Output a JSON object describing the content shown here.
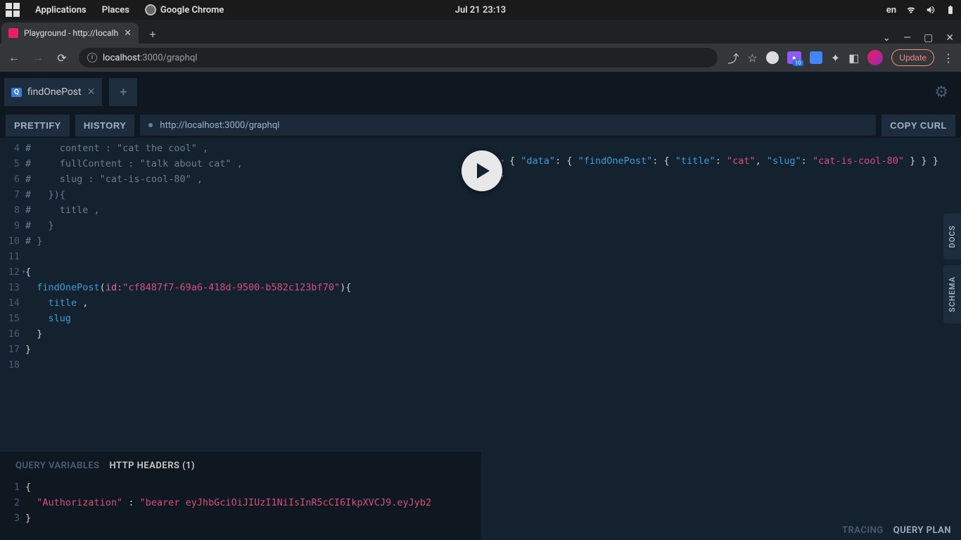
{
  "os": {
    "applications": "Applications",
    "places": "Places",
    "chrome": "Google Chrome",
    "datetime": "Jul 21  23:13",
    "lang": "en"
  },
  "browser": {
    "tab_title": "Playground - http://localh",
    "url_host": "localhost",
    "url_rest": ":3000/graphql",
    "update": "Update",
    "ext_badge": "10"
  },
  "playground": {
    "tab_name": "findOnePost",
    "prettify": "PRETTIFY",
    "history": "HISTORY",
    "endpoint": "http://localhost:3000/graphql",
    "copy_curl": "COPY CURL",
    "docs": "DOCS",
    "schema": "SCHEMA",
    "tracing": "TRACING",
    "query_plan": "QUERY PLAN",
    "qv_label": "QUERY VARIABLES",
    "hh_label": "HTTP HEADERS (1)"
  },
  "editor": {
    "l4a": "#     content : ",
    "l4b": "\"cat the cool\"",
    "l4c": " ,",
    "l5a": "#     fullContent : ",
    "l5b": "\"talk about cat\"",
    "l5c": " ,",
    "l6a": "#     slug : ",
    "l6b": "\"cat-is-cool-80\"",
    "l6c": " ,",
    "l7": "#   }){",
    "l8": "#     title ,",
    "l9": "#   }",
    "l10": "# }",
    "l12": "{",
    "l13_fn": "findOnePost",
    "l13_arg": "id",
    "l13_str": "\"cf8487f7-69a6-418d-9500-b582c123bf70\"",
    "l14": "title",
    "l15": "slug",
    "l16": "}",
    "l17": "}"
  },
  "headers": {
    "l1": "{",
    "l2_key": "\"Authorization\"",
    "l2_colon": " : ",
    "l2_val": "\"bearer eyJhbGciOiJIUzI1NiIsInR5cCI6IkpXVCJ9.eyJyb2",
    "l3": "}"
  },
  "result": {
    "data": "\"data\"",
    "findOnePost": "\"findOnePost\"",
    "title_k": "\"title\"",
    "title_v": "\"cat\"",
    "slug_k": "\"slug\"",
    "slug_v": "\"cat-is-cool-80\""
  }
}
